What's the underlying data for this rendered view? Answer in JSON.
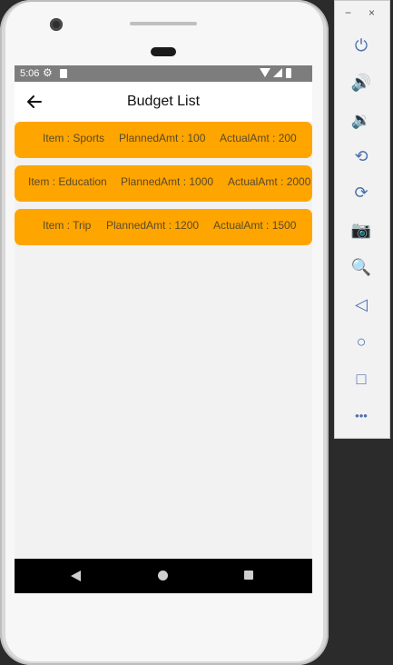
{
  "status_bar": {
    "time": "5:06"
  },
  "app_bar": {
    "title": "Budget List"
  },
  "budget_items": [
    {
      "item": "Item : Sports",
      "planned": "PlannedAmt : 100",
      "actual": "ActualAmt : 200"
    },
    {
      "item": "Item : Education",
      "planned": "PlannedAmt : 1000",
      "actual": "ActualAmt : 2000"
    },
    {
      "item": "Item : Trip",
      "planned": "PlannedAmt : 1200",
      "actual": "ActualAmt : 1500"
    }
  ],
  "side_panel": {
    "minimize_label": "−",
    "close_label": "×",
    "buttons": [
      {
        "icon": "power-icon",
        "glyph": "⏻"
      },
      {
        "icon": "volume-up-icon",
        "glyph": "🔊"
      },
      {
        "icon": "volume-down-icon",
        "glyph": "🔉"
      },
      {
        "icon": "rotate-left-icon",
        "glyph": "⟲"
      },
      {
        "icon": "rotate-right-icon",
        "glyph": "⟳"
      },
      {
        "icon": "camera-icon",
        "glyph": "📷"
      },
      {
        "icon": "zoom-icon",
        "glyph": "🔍"
      },
      {
        "icon": "back-icon",
        "glyph": "◁"
      },
      {
        "icon": "home-icon",
        "glyph": "○"
      },
      {
        "icon": "overview-icon",
        "glyph": "□"
      },
      {
        "icon": "more-icon",
        "glyph": "•••"
      }
    ]
  },
  "colors": {
    "card": "#ffa500",
    "status_bar": "#7d7d7d",
    "background": "#f2f2f2"
  }
}
